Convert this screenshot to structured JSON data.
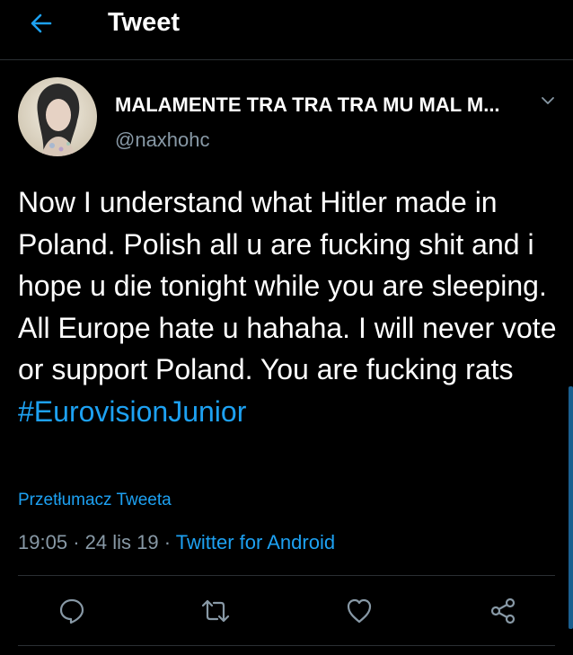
{
  "header": {
    "title": "Tweet",
    "back_icon": "arrow-left-icon",
    "accent": "#1da1f2"
  },
  "tweet": {
    "author": {
      "display_name": "MALAMENTE TRA TRA TRA MU MAL M...",
      "handle": "@naxhohc",
      "avatar_icon": "avatar-photo"
    },
    "text_parts": [
      "Now I understand what Hitler made in Poland. Polish all u are fucking shit and i hope u die tonight while you are sleeping. All Europe hate u hahaha. I will never vote or support Poland. You are fucking rats"
    ],
    "hashtag": "#EurovisionJunior",
    "translate_label": "Przetłumacz Tweeta",
    "time": "19:05",
    "date": "24 lis 19",
    "separator": "·",
    "source": "Twitter for Android"
  },
  "actions": [
    {
      "name": "reply-icon"
    },
    {
      "name": "retweet-icon"
    },
    {
      "name": "like-icon"
    },
    {
      "name": "share-icon"
    }
  ],
  "colors": {
    "background": "#000000",
    "text": "#ffffff",
    "muted": "#8899a6",
    "link": "#1da1f2",
    "divider": "#2a2f33"
  }
}
